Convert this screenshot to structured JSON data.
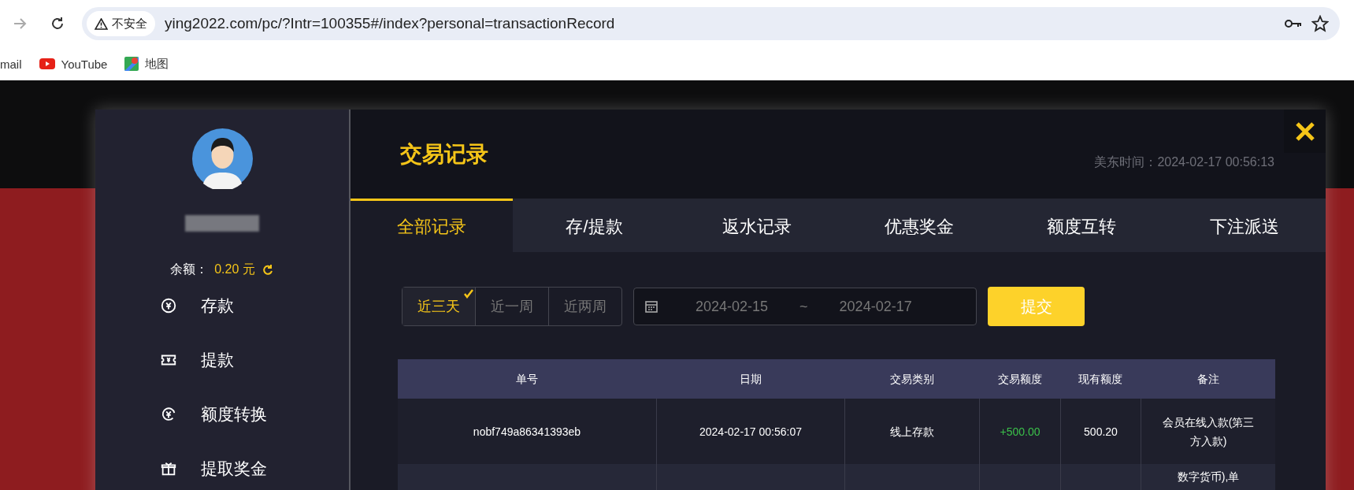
{
  "browser": {
    "security_label": "不安全",
    "url": "ying2022.com/pc/?Intr=100355#/index?personal=transactionRecord",
    "bookmarks": [
      {
        "label": "mail",
        "kind": "plain"
      },
      {
        "label": "YouTube",
        "kind": "youtube"
      },
      {
        "label": "地图",
        "kind": "maps"
      }
    ]
  },
  "sidebar": {
    "balance_label": "余额：",
    "balance_value": "0.20 元",
    "menu": [
      {
        "label": "存款",
        "kind": "deposit"
      },
      {
        "label": "提款",
        "kind": "withdraw"
      },
      {
        "label": "额度转换",
        "kind": "transfer"
      },
      {
        "label": "提取奖金",
        "kind": "bonus"
      }
    ]
  },
  "main": {
    "title": "交易记录",
    "server_time": "美东时间：2024-02-17 00:56:13",
    "tabs": [
      {
        "label": "全部记录",
        "selected": true
      },
      {
        "label": "存/提款",
        "selected": false
      },
      {
        "label": "返水记录",
        "selected": false
      },
      {
        "label": "优惠奖金",
        "selected": false
      },
      {
        "label": "额度互转",
        "selected": false
      },
      {
        "label": "下注派送",
        "selected": false
      }
    ],
    "ranges": [
      {
        "label": "近三天",
        "selected": true
      },
      {
        "label": "近一周",
        "selected": false
      },
      {
        "label": "近两周",
        "selected": false
      }
    ],
    "date_from": "2024-02-15",
    "date_separator": "~",
    "date_to": "2024-02-17",
    "submit": "提交",
    "table": {
      "columns": [
        "单号",
        "日期",
        "交易类别",
        "交易额度",
        "现有额度",
        "备注"
      ],
      "rows": [
        {
          "cells": [
            "nobf749a86341393eb",
            "2024-02-17 00:56:07",
            "线上存款",
            "+500.00",
            "500.20",
            "会员在线入款(第三方入款)"
          ]
        },
        {
          "cells": [
            null,
            null,
            null,
            null,
            null,
            "数字货币),单"
          ]
        }
      ]
    }
  }
}
